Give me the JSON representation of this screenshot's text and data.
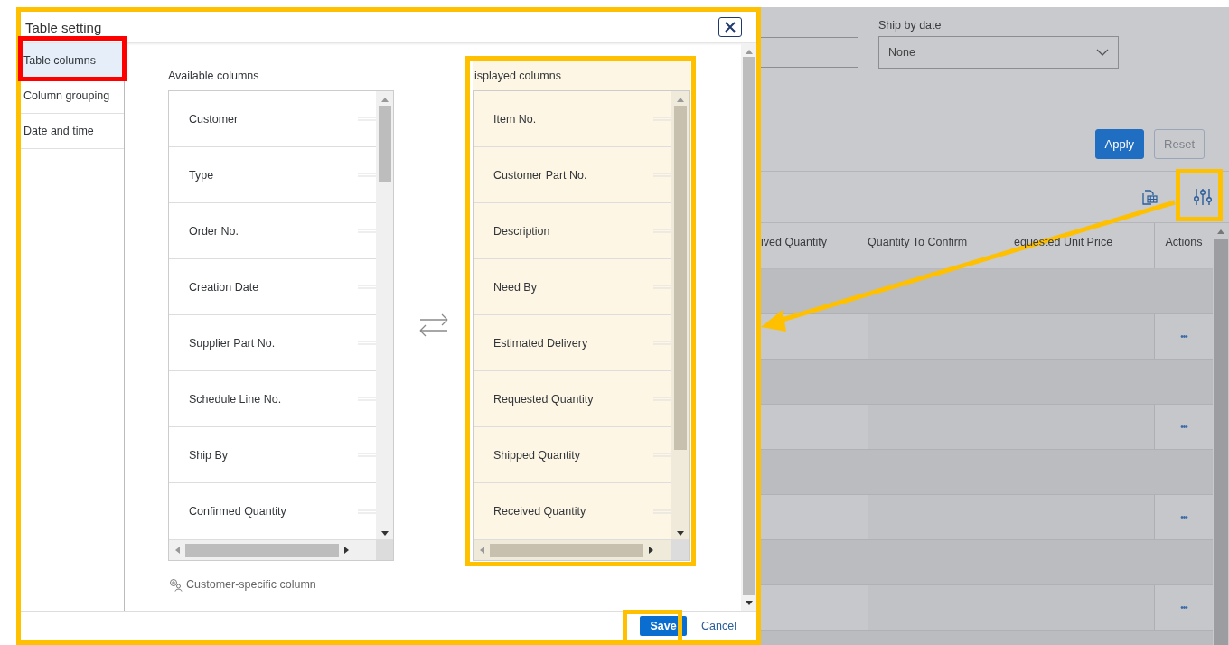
{
  "dialog": {
    "title": "Table setting",
    "nav": [
      {
        "label": "Table columns",
        "selected": true
      },
      {
        "label": "Column grouping",
        "selected": false
      },
      {
        "label": "Date and time",
        "selected": false
      }
    ],
    "available": {
      "title": "Available columns",
      "items": [
        "Customer",
        "Type",
        "Order No.",
        "Creation Date",
        "Supplier Part No.",
        "Schedule Line No.",
        "Ship By",
        "Confirmed Quantity"
      ]
    },
    "displayed": {
      "title": "isplayed columns",
      "items": [
        "Item No.",
        "Customer Part No.",
        "Description",
        "Need By",
        "Estimated Delivery",
        "Requested Quantity",
        "Shipped Quantity",
        "Received Quantity"
      ]
    },
    "custom_column_link": "Customer-specific column",
    "buttons": [
      {
        "label": "Save",
        "kind": "primary"
      },
      {
        "label": "Cancel",
        "kind": "link"
      }
    ]
  },
  "app": {
    "filter": {
      "label": "Ship by date",
      "value": "None"
    },
    "buttons": [
      {
        "label": "Apply",
        "kind": "primary",
        "disabled": false
      },
      {
        "label": "Reset",
        "kind": "secondary",
        "disabled": true
      }
    ],
    "table": {
      "columns": [
        "ived Quantity",
        "Quantity To Confirm",
        "equested Unit Price",
        "Actions"
      ],
      "rows": [
        {
          "kind": "group"
        },
        {
          "kind": "item",
          "actions": "•••"
        },
        {
          "kind": "group"
        },
        {
          "kind": "item",
          "actions": "•••"
        },
        {
          "kind": "group"
        },
        {
          "kind": "item",
          "actions": "•••"
        },
        {
          "kind": "group"
        },
        {
          "kind": "item",
          "actions": "•••"
        },
        {
          "kind": "group"
        }
      ]
    }
  }
}
